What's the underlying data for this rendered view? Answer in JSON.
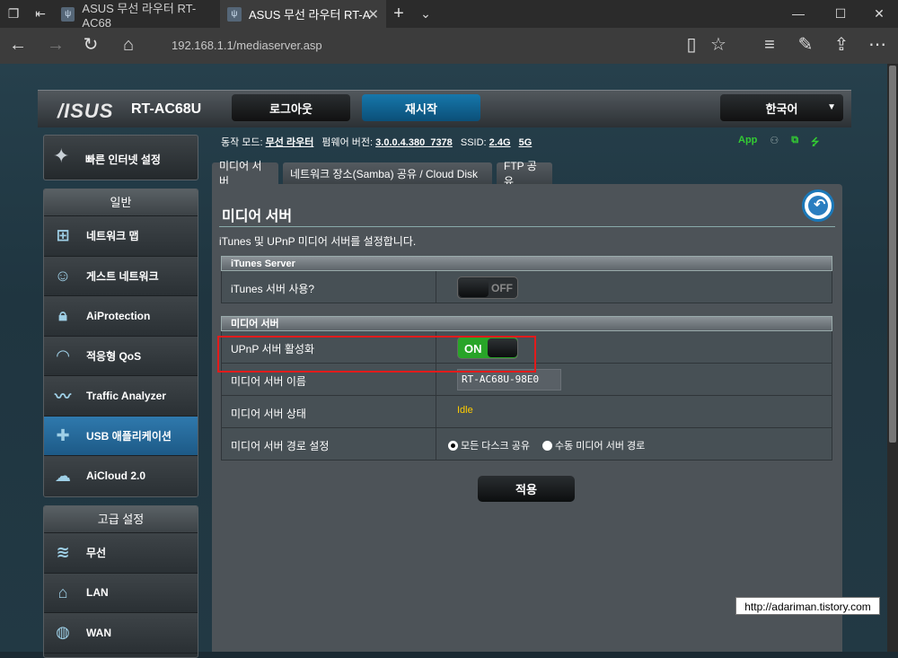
{
  "browser": {
    "tabs": [
      {
        "title": "ASUS 무선 라우터 RT-AC68"
      },
      {
        "title": "ASUS 무선 라우터 RT-A"
      }
    ],
    "url": "192.168.1.1/mediaserver.asp"
  },
  "header": {
    "logo": "/ISUS",
    "model": "RT-AC68U",
    "logout": "로그아웃",
    "reboot": "재시작",
    "language": "한국어"
  },
  "sidebar": {
    "quick_setup": "빠른 인터넷 설정",
    "general_title": "일반",
    "general_items": [
      {
        "label": "네트워크 맵",
        "icon": "network-map-icon"
      },
      {
        "label": "게스트 네트워크",
        "icon": "guest-network-icon"
      },
      {
        "label": "AiProtection",
        "icon": "lock-icon"
      },
      {
        "label": "적응형 QoS",
        "icon": "speedometer-icon"
      },
      {
        "label": "Traffic Analyzer",
        "icon": "traffic-chart-icon"
      },
      {
        "label": "USB 애플리케이션",
        "icon": "puzzle-icon"
      },
      {
        "label": "AiCloud 2.0",
        "icon": "cloud-icon"
      }
    ],
    "advanced_title": "고급 설정",
    "advanced_items": [
      {
        "label": "무선",
        "icon": "wifi-icon"
      },
      {
        "label": "LAN",
        "icon": "home-icon"
      },
      {
        "label": "WAN",
        "icon": "globe-icon"
      }
    ]
  },
  "status": {
    "mode_label": "동작 모드:",
    "mode": "무선 라우터",
    "firmware_label": "펌웨어 버전:",
    "firmware": "3.0.0.4.380_7378",
    "ssid_label": "SSID:",
    "ssid_24": "2.4G",
    "ssid_5": "5G",
    "app": "App"
  },
  "content_tabs": [
    "미디어 서버",
    "네트워크 장소(Samba) 공유 / Cloud Disk",
    "FTP 공유"
  ],
  "content": {
    "title": "미디어 서버",
    "description": "iTunes 및 UPnP 미디어 서버를 설정합니다.",
    "itunes_section": "iTunes Server",
    "itunes_enable_label": "iTunes 서버 사용?",
    "itunes_toggle": "OFF",
    "media_section": "미디어 서버",
    "upnp_label": "UPnP 서버 활성화",
    "upnp_toggle": "ON",
    "server_name_label": "미디어 서버 이름",
    "server_name": "RT-AC68U-98E0",
    "server_status_label": "미디어 서버 상태",
    "server_status": "Idle",
    "path_label": "미디어 서버 경로 설정",
    "path_opt1": "모든 다스크 공유",
    "path_opt2": "수동 미디어 서버 경로",
    "apply": "적용"
  },
  "watermark": "http://adariman.tistory.com"
}
